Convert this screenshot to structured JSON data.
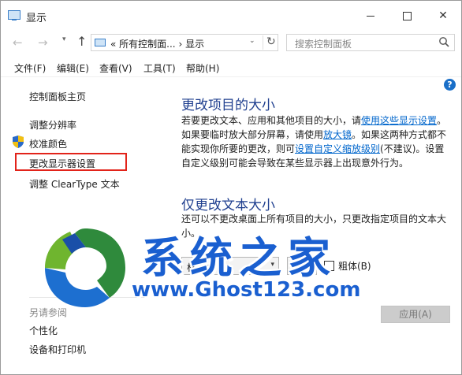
{
  "window": {
    "title": "显示",
    "minimize_glyph": "—",
    "close_glyph": "✕"
  },
  "nav": {
    "back_icon": "arrow-left-icon",
    "forward_icon": "arrow-right-icon",
    "up_icon": "arrow-up-icon",
    "address_prefix": "«",
    "address_crumb1": "所有控制面...",
    "address_sep": "›",
    "address_crumb2": "显示",
    "search_placeholder": "搜索控制面板"
  },
  "menu": [
    "文件(F)",
    "编辑(E)",
    "查看(V)",
    "工具(T)",
    "帮助(H)"
  ],
  "left": {
    "items": [
      "控制面板主页",
      "调整分辨率",
      "校准颜色",
      "更改显示器设置",
      "调整 ClearType 文本"
    ],
    "see_also_title": "另请参阅",
    "see_also": [
      "个性化",
      "设备和打印机"
    ]
  },
  "main": {
    "heading": "更改项目的大小",
    "para_part1": "若要更改文本、应用和其他项目的大小，请",
    "link_settings": "使用这些显示设置",
    "para_part2": "。如果要临时放大部分屏幕，请使用",
    "link_magnifier": "放大镜",
    "para_part3": "。如果这两种方式都不能实现你所要的更改，则可",
    "link_custom": "设置自定义缩放级别",
    "para_part4": "(不建议)。设置自定义级别可能会导致在某些显示器上出现意外行为。",
    "subheading": "仅更改文本大小",
    "para2": "还可以不更改桌面上所有项目的大小，只更改指定项目的文本大小。",
    "element_select": "标题栏",
    "size_select": "9",
    "bold_label": "粗体(B)",
    "bold_checked": false,
    "apply_button": "应用(A)"
  },
  "watermark": {
    "title": "系统之家",
    "url": "www.Ghost123.com"
  },
  "colors": {
    "accent_link": "#0066cc",
    "heading": "#1f3f8f",
    "highlight": "#e2231a",
    "watermark": "#1a5fd0"
  }
}
